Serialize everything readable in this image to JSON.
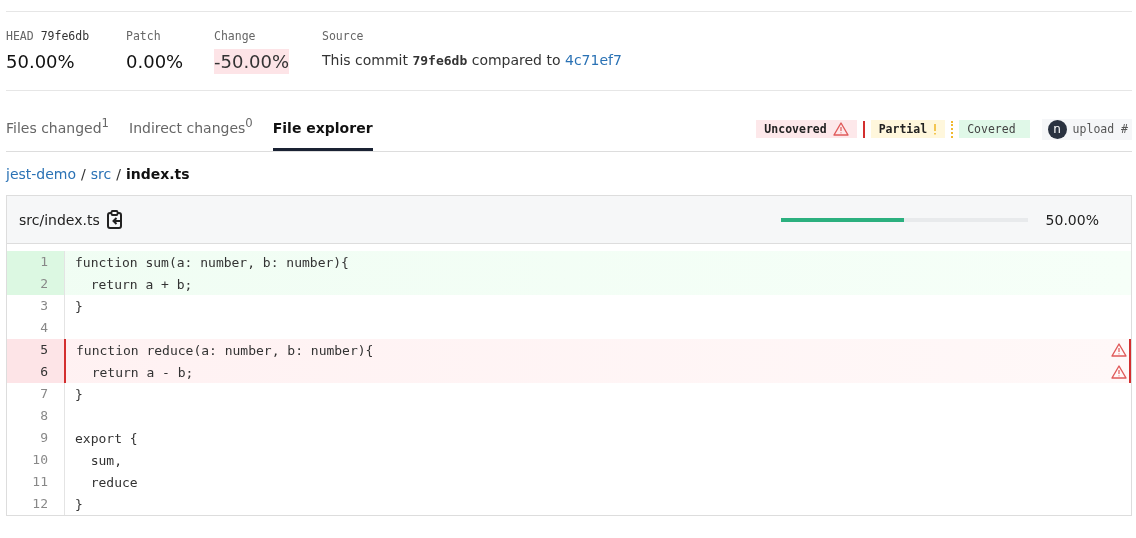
{
  "summary": [
    {
      "label": "HEAD",
      "label_code": "79fe6db",
      "value": "50.00%",
      "kind": "plain"
    },
    {
      "label": "Patch",
      "value": "0.00%",
      "kind": "plain"
    },
    {
      "label": "Change",
      "value": "-50.00%",
      "kind": "negative"
    }
  ],
  "source": {
    "label": "Source",
    "prefix": "This commit",
    "commit": "79fe6db",
    "middle": "compared to",
    "base": "4c71ef7"
  },
  "tabs": [
    {
      "label": "Files changed$^{1}$",
      "selected": false
    },
    {
      "label": "Indirect changes$^{0}$",
      "selected": false
    },
    {
      "label": "File explorer",
      "selected": true
    }
  ],
  "legend": [
    {
      "kind": "uncovered",
      "label": "Uncovered"
    },
    {
      "kind": "partial",
      "label": "Partial"
    },
    {
      "kind": "covered",
      "label": "Covered"
    }
  ],
  "upload": {
    "avatar": "n",
    "label": "upload #"
  },
  "breadcrumb": [
    {
      "label": "jest-demo",
      "link": true
    },
    {
      "label": "src",
      "link": true
    },
    {
      "label": "index.ts",
      "link": false
    }
  ],
  "separators": [
    "/",
    "/"
  ],
  "file": {
    "path": "src/index.ts",
    "coverage": {
      "level": 0.5,
      "reading": "50.00%"
    },
    "lines": [
      {
        "number": "1",
        "code": "function sum(a: number, b: number){",
        "kind": "covered"
      },
      {
        "number": "2",
        "code": "  return a + b;",
        "kind": "covered"
      },
      {
        "number": "3",
        "code": "}",
        "kind": "none"
      },
      {
        "number": "4",
        "kind": "none"
      },
      {
        "number": "5",
        "code": "function reduce(a: number, b: number){",
        "kind": "uncovered"
      },
      {
        "number": "6",
        "code": "  return a - b;",
        "kind": "uncovered"
      },
      {
        "number": "7",
        "code": "}",
        "kind": "none"
      },
      {
        "number": "8",
        "kind": "none"
      },
      {
        "number": "9",
        "code": "export {",
        "kind": "none"
      },
      {
        "number": "10",
        "code": "  sum,",
        "kind": "none"
      },
      {
        "number": "11",
        "code": "  reduce",
        "kind": "none"
      },
      {
        "number": "12",
        "code": "}",
        "kind": "none"
      }
    ]
  }
}
